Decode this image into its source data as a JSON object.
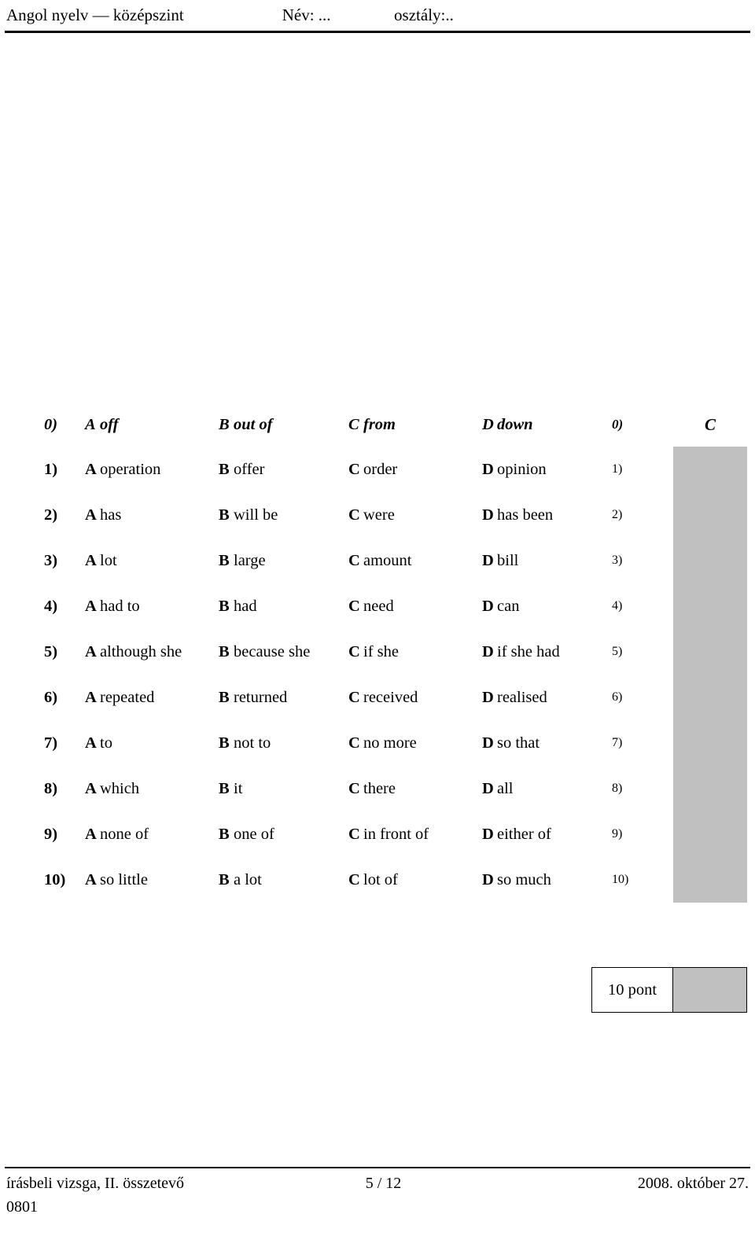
{
  "header": {
    "left": "Angol nyelv — középszint",
    "name_label": "Név: ...",
    "class_label": "osztály:.."
  },
  "table": {
    "rows": [
      {
        "num": "0)",
        "options": [
          {
            "letter": "A",
            "word": "off"
          },
          {
            "letter": "B",
            "word": "out of"
          },
          {
            "letter": "C",
            "word": "from"
          },
          {
            "letter": "D",
            "word": "down"
          }
        ],
        "index": "0)",
        "answer": "C"
      },
      {
        "num": "1)",
        "options": [
          {
            "letter": "A",
            "word": "operation"
          },
          {
            "letter": "B",
            "word": "offer"
          },
          {
            "letter": "C",
            "word": "order"
          },
          {
            "letter": "D",
            "word": "opinion"
          }
        ],
        "index": "1)",
        "answer": ""
      },
      {
        "num": "2)",
        "options": [
          {
            "letter": "A",
            "word": "has"
          },
          {
            "letter": "B",
            "word": "will be"
          },
          {
            "letter": "C",
            "word": "were"
          },
          {
            "letter": "D",
            "word": "has been"
          }
        ],
        "index": "2)",
        "answer": ""
      },
      {
        "num": "3)",
        "options": [
          {
            "letter": "A",
            "word": "lot"
          },
          {
            "letter": "B",
            "word": "large"
          },
          {
            "letter": "C",
            "word": "amount"
          },
          {
            "letter": "D",
            "word": "bill"
          }
        ],
        "index": "3)",
        "answer": ""
      },
      {
        "num": "4)",
        "options": [
          {
            "letter": "A",
            "word": "had to"
          },
          {
            "letter": "B",
            "word": "had"
          },
          {
            "letter": "C",
            "word": "need"
          },
          {
            "letter": "D",
            "word": "can"
          }
        ],
        "index": "4)",
        "answer": ""
      },
      {
        "num": "5)",
        "options": [
          {
            "letter": "A",
            "word": "although she"
          },
          {
            "letter": "B",
            "word": "because she"
          },
          {
            "letter": "C",
            "word": "if she"
          },
          {
            "letter": "D",
            "word": "if she had"
          }
        ],
        "index": "5)",
        "answer": ""
      },
      {
        "num": "6)",
        "options": [
          {
            "letter": "A",
            "word": "repeated"
          },
          {
            "letter": "B",
            "word": "returned"
          },
          {
            "letter": "C",
            "word": "received"
          },
          {
            "letter": "D",
            "word": "realised"
          }
        ],
        "index": "6)",
        "answer": ""
      },
      {
        "num": "7)",
        "options": [
          {
            "letter": "A",
            "word": "to"
          },
          {
            "letter": "B",
            "word": "not to"
          },
          {
            "letter": "C",
            "word": "no more"
          },
          {
            "letter": "D",
            "word": "so that"
          }
        ],
        "index": "7)",
        "answer": ""
      },
      {
        "num": "8)",
        "options": [
          {
            "letter": "A",
            "word": "which"
          },
          {
            "letter": "B",
            "word": "it"
          },
          {
            "letter": "C",
            "word": "there"
          },
          {
            "letter": "D",
            "word": "all"
          }
        ],
        "index": "8)",
        "answer": ""
      },
      {
        "num": "9)",
        "options": [
          {
            "letter": "A",
            "word": "none of"
          },
          {
            "letter": "B",
            "word": "one of"
          },
          {
            "letter": "C",
            "word": "in front of"
          },
          {
            "letter": "D",
            "word": "either of"
          }
        ],
        "index": "9)",
        "answer": ""
      },
      {
        "num": "10)",
        "options": [
          {
            "letter": "A",
            "word": "so little"
          },
          {
            "letter": "B",
            "word": "a lot"
          },
          {
            "letter": "C",
            "word": "lot of"
          },
          {
            "letter": "D",
            "word": "so much"
          }
        ],
        "index": "10)",
        "answer": ""
      }
    ]
  },
  "points": {
    "label": "10 pont"
  },
  "footer": {
    "left": "írásbeli vizsga, II. összetevő",
    "center": "5 / 12",
    "right": "2008. október 27.",
    "code": "0801"
  }
}
